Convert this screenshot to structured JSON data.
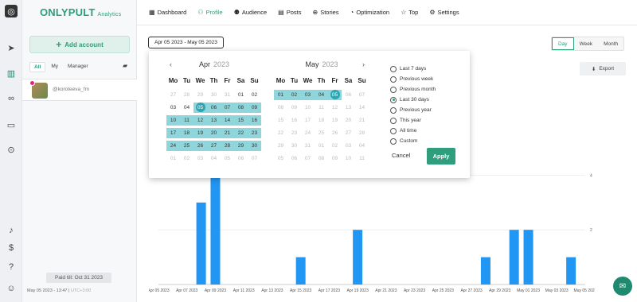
{
  "brand": {
    "name": "ONLYPULT",
    "sub": "Analytics"
  },
  "sidebar": {
    "add_account": "Add account",
    "filters": [
      "All",
      "My",
      "Manager"
    ],
    "account": "@koroteeva_fm",
    "paid_till": "Paid till: Oct 31 2023",
    "timestamp": "May 05 2023 - 13:47",
    "timezone": "UTC+3:00"
  },
  "nav": {
    "tabs": [
      {
        "label": "Dashboard",
        "icon": "grid-icon"
      },
      {
        "label": "Profile",
        "icon": "person-icon"
      },
      {
        "label": "Audience",
        "icon": "group-icon"
      },
      {
        "label": "Posts",
        "icon": "posts-icon"
      },
      {
        "label": "Stories",
        "icon": "stories-icon"
      },
      {
        "label": "Optimization",
        "icon": "gauge-icon"
      },
      {
        "label": "Top",
        "icon": "star-icon"
      },
      {
        "label": "Settings",
        "icon": "gear-icon"
      }
    ],
    "active": "Profile"
  },
  "date_range": "Apr 05 2023 - May 05 2023",
  "period_toggle": {
    "options": [
      "Day",
      "Week",
      "Month"
    ],
    "selected": "Day"
  },
  "export_label": "Export",
  "calendar": {
    "weekdays": [
      "Mo",
      "Tu",
      "We",
      "Th",
      "Fr",
      "Sa",
      "Su"
    ],
    "left": {
      "month": "Apr",
      "year": "2023",
      "weeks": [
        [
          "27",
          "28",
          "29",
          "30",
          "31",
          "01",
          "02"
        ],
        [
          "03",
          "04",
          "05",
          "06",
          "07",
          "08",
          "09"
        ],
        [
          "10",
          "11",
          "12",
          "13",
          "14",
          "15",
          "16"
        ],
        [
          "17",
          "18",
          "19",
          "20",
          "21",
          "22",
          "23"
        ],
        [
          "24",
          "25",
          "26",
          "27",
          "28",
          "29",
          "30"
        ],
        [
          "01",
          "02",
          "03",
          "04",
          "05",
          "06",
          "07"
        ]
      ]
    },
    "right": {
      "month": "May",
      "year": "2023",
      "weeks": [
        [
          "01",
          "02",
          "03",
          "04",
          "05",
          "06",
          "07"
        ],
        [
          "08",
          "09",
          "10",
          "11",
          "12",
          "13",
          "14"
        ],
        [
          "15",
          "16",
          "17",
          "18",
          "19",
          "20",
          "21"
        ],
        [
          "22",
          "23",
          "24",
          "25",
          "26",
          "27",
          "28"
        ],
        [
          "29",
          "30",
          "31",
          "01",
          "02",
          "03",
          "04"
        ],
        [
          "05",
          "06",
          "07",
          "08",
          "09",
          "10",
          "11"
        ]
      ]
    },
    "presets": [
      "Last 7 days",
      "Previous week",
      "Previous month",
      "Last 30 days",
      "Previous year",
      "This year",
      "All time",
      "Custom"
    ],
    "selected_preset": "Last 30 days",
    "cancel_label": "Cancel",
    "apply_label": "Apply"
  },
  "chart_data": {
    "type": "bar",
    "x": [
      "Apr 05 2023",
      "Apr 06 2023",
      "Apr 07 2023",
      "Apr 08 2023",
      "Apr 09 2023",
      "Apr 10 2023",
      "Apr 11 2023",
      "Apr 12 2023",
      "Apr 13 2023",
      "Apr 14 2023",
      "Apr 15 2023",
      "Apr 16 2023",
      "Apr 17 2023",
      "Apr 18 2023",
      "Apr 19 2023",
      "Apr 20 2023",
      "Apr 21 2023",
      "Apr 22 2023",
      "Apr 23 2023",
      "Apr 24 2023",
      "Apr 25 2023",
      "Apr 26 2023",
      "Apr 27 2023",
      "Apr 28 2023",
      "Apr 29 2023",
      "Apr 30 2023",
      "May 01 2023",
      "May 02 2023",
      "May 03 2023",
      "May 04 2023",
      "May 05 2023"
    ],
    "values": [
      0,
      0,
      0,
      3,
      4,
      0,
      0,
      0,
      0,
      0,
      1,
      0,
      0,
      0,
      2,
      0,
      0,
      0,
      0,
      0,
      0,
      0,
      0,
      1,
      0,
      2,
      2,
      0,
      0,
      1,
      0
    ],
    "xtick_labels": [
      "Apr 05 2023",
      "Apr 07 2023",
      "Apr 09 2023",
      "Apr 11 2023",
      "Apr 13 2023",
      "Apr 15 2023",
      "Apr 17 2023",
      "Apr 19 2023",
      "Apr 21 2023",
      "Apr 23 2023",
      "Apr 25 2023",
      "Apr 27 2023",
      "Apr 29 2023",
      "May 01 2023",
      "May 03 2023",
      "May 05 2023"
    ],
    "ytick_labels": [
      "4",
      "2"
    ],
    "ylim": [
      0,
      5
    ],
    "bar_color": "#2196f3"
  },
  "colors": {
    "accent": "#2e9e7d",
    "range": "#8fd5dc",
    "endpoint": "#2aa7b5"
  }
}
